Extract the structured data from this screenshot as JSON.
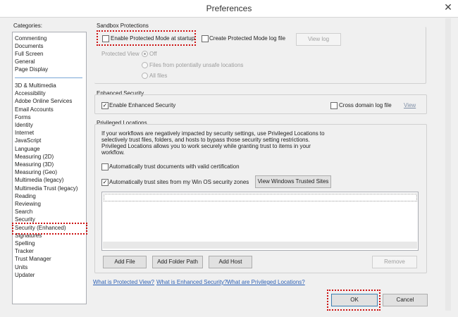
{
  "window": {
    "title": "Preferences",
    "close_glyph": "✕"
  },
  "categories": {
    "heading": "Categories:",
    "group1": [
      "Commenting",
      "Documents",
      "Full Screen",
      "General",
      "Page Display"
    ],
    "group2": [
      "3D & Multimedia",
      "Accessibility",
      "Adobe Online Services",
      "Email Accounts",
      "Forms",
      "Identity",
      "Internet",
      "JavaScript",
      "Language",
      "Measuring (2D)",
      "Measuring (3D)",
      "Measuring (Geo)",
      "Multimedia (legacy)",
      "Multimedia Trust (legacy)",
      "Reading",
      "Reviewing",
      "Search",
      "Security",
      "Security (Enhanced)",
      "Signatures",
      "Spelling",
      "Tracker",
      "Trust Manager",
      "Units",
      "Updater"
    ],
    "selected": "Security (Enhanced)"
  },
  "sandbox": {
    "legend": "Sandbox Protections",
    "enable_protected_mode": {
      "label": "Enable Protected Mode at startup",
      "checked": false
    },
    "create_log": {
      "label": "Create Protected Mode log file",
      "checked": false
    },
    "view_log_button": "View log",
    "protected_view_label": "Protected View",
    "options": [
      {
        "label": "Off",
        "selected": true
      },
      {
        "label": "Files from potentially unsafe locations",
        "selected": false
      },
      {
        "label": "All files",
        "selected": false
      }
    ]
  },
  "enhanced": {
    "legend": "Enhanced Security",
    "enable": {
      "label": "Enable Enhanced Security",
      "checked": true
    },
    "cross_domain": {
      "label": "Cross domain log file",
      "checked": false
    },
    "view_link": "View"
  },
  "privileged": {
    "legend": "Privileged Locations",
    "description_lines": [
      "If your workflows are negatively impacted by security settings, use Privileged Locations to",
      "selectively trust files, folders, and hosts to bypass those security setting restrictions.",
      "Privileged Locations allows you to work securely while granting trust to items in your",
      "workflow."
    ],
    "trust_cert": {
      "label": "Automatically trust documents with valid certification",
      "checked": false
    },
    "trust_sites": {
      "label": "Automatically trust sites from my Win OS security zones",
      "checked": true
    },
    "view_trusted_button": "View Windows Trusted Sites",
    "add_file_button": "Add File",
    "add_folder_button": "Add Folder Path",
    "add_host_button": "Add Host",
    "remove_button": "Remove"
  },
  "links": {
    "protected_view": "What is Protected View?",
    "enhanced_security": "What is Enhanced Security?",
    "privileged_locations": "What are Privileged Locations?"
  },
  "footer": {
    "ok": "OK",
    "cancel": "Cancel"
  },
  "colors": {
    "highlight": "#cc1111",
    "link": "#2b5fb4",
    "frame": "#f0f0f0"
  }
}
